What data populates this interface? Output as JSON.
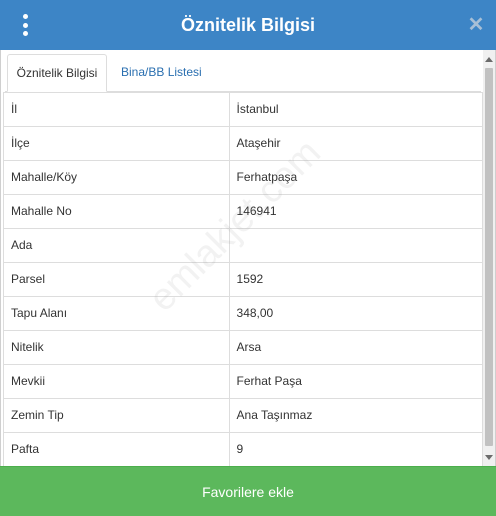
{
  "header": {
    "title": "Öznitelik Bilgisi",
    "menu_icon": "vertical-dots-icon",
    "close_icon": "close-icon",
    "close_glyph": "✕"
  },
  "tabs": [
    {
      "label": "Öznitelik Bilgisi",
      "active": true
    },
    {
      "label": "Bina/BB Listesi",
      "active": false
    }
  ],
  "rows": [
    {
      "key": "İl",
      "value": "İstanbul"
    },
    {
      "key": "İlçe",
      "value": "Ataşehir"
    },
    {
      "key": "Mahalle/Köy",
      "value": "Ferhatpaşa"
    },
    {
      "key": "Mahalle No",
      "value": "146941"
    },
    {
      "key": "Ada",
      "value": ""
    },
    {
      "key": "Parsel",
      "value": "1592"
    },
    {
      "key": "Tapu Alanı",
      "value": "348,00"
    },
    {
      "key": "Nitelik",
      "value": "Arsa"
    },
    {
      "key": "Mevkii",
      "value": "Ferhat Paşa"
    },
    {
      "key": "Zemin Tip",
      "value": "Ana Taşınmaz"
    },
    {
      "key": "Pafta",
      "value": "9"
    }
  ],
  "watermark": "emlakjet.com",
  "footer": {
    "button_label": "Favorilere ekle"
  },
  "colors": {
    "header_bg": "#3d85c6",
    "tab_link": "#2a6fb0",
    "footer_bg": "#5cb85c"
  }
}
